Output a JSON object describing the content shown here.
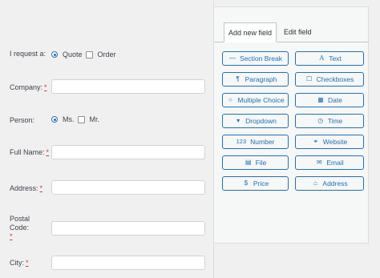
{
  "form": {
    "request": {
      "label": "I request a:",
      "option_quote": "Quote",
      "option_order": "Order",
      "selected": "Quote"
    },
    "company": {
      "label": "Company:",
      "required_mark": "*",
      "value": ""
    },
    "person": {
      "label": "Person:",
      "option_ms": "Ms.",
      "option_mr": "Mr.",
      "selected": "Ms."
    },
    "full_name": {
      "label": "Full Name:",
      "required_mark": "*",
      "value": ""
    },
    "address": {
      "label": "Address:",
      "required_mark": "*",
      "value": ""
    },
    "postal_code": {
      "label": "Postal Code:",
      "required_mark": "*",
      "value": ""
    },
    "city": {
      "label": "City:",
      "required_mark": "*",
      "value": ""
    }
  },
  "panel": {
    "tabs": [
      {
        "label": "Add new field",
        "active": true
      },
      {
        "label": "Edit field",
        "active": false
      }
    ],
    "fields": [
      {
        "label": "Section Break",
        "icon": "minus-icon",
        "glyph": "—"
      },
      {
        "label": "Text",
        "icon": "text-icon",
        "glyph": "A"
      },
      {
        "label": "Paragraph",
        "icon": "paragraph-icon",
        "glyph": "¶"
      },
      {
        "label": "Checkboxes",
        "icon": "checkbox-icon",
        "glyph": "☐"
      },
      {
        "label": "Multiple Choice",
        "icon": "radio-icon",
        "glyph": "○"
      },
      {
        "label": "Date",
        "icon": "calendar-icon",
        "glyph": "▦"
      },
      {
        "label": "Dropdown",
        "icon": "caret-down-icon",
        "glyph": "▾"
      },
      {
        "label": "Time",
        "icon": "clock-icon",
        "glyph": "◷"
      },
      {
        "label": "Number",
        "icon": "number-icon",
        "glyph": "123"
      },
      {
        "label": "Website",
        "icon": "link-icon",
        "glyph": "⚭"
      },
      {
        "label": "File",
        "icon": "file-icon",
        "glyph": "▤"
      },
      {
        "label": "Email",
        "icon": "envelope-icon",
        "glyph": "✉"
      },
      {
        "label": "Price",
        "icon": "dollar-icon",
        "glyph": "$"
      },
      {
        "label": "Address",
        "icon": "home-icon",
        "glyph": "⌂"
      }
    ]
  },
  "colors": {
    "accent": "#2271b1",
    "required": "#d63638",
    "panel_bg": "#f6f7f7",
    "page_bg": "#f0f0f1"
  }
}
